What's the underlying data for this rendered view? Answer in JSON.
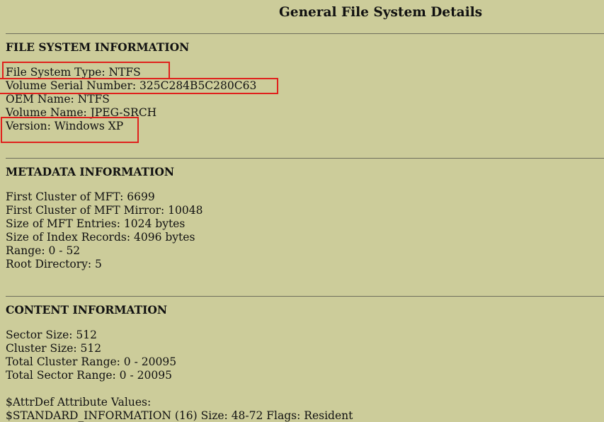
{
  "page": {
    "title": "General File System Details"
  },
  "file_system": {
    "heading": "FILE SYSTEM INFORMATION",
    "type": "File System Type: NTFS",
    "serial": "Volume Serial Number: 325C284B5C280C63",
    "oem": "OEM Name: NTFS",
    "volume_name": "Volume Name: JPEG-SRCH",
    "version": "Version: Windows XP"
  },
  "metadata": {
    "heading": "METADATA INFORMATION",
    "mft_first_cluster": "First Cluster of MFT: 6699",
    "mft_mirror_first_cluster": "First Cluster of MFT Mirror: 10048",
    "mft_entry_size": "Size of MFT Entries: 1024 bytes",
    "index_record_size": "Size of Index Records: 4096 bytes",
    "range": "Range: 0 - 52",
    "root_directory": "Root Directory: 5"
  },
  "content": {
    "heading": "CONTENT INFORMATION",
    "sector_size": "Sector Size: 512",
    "cluster_size": "Cluster Size: 512",
    "total_cluster_range": "Total Cluster Range: 0 - 20095",
    "total_sector_range": "Total Sector Range: 0 - 20095",
    "attrdef_title": "$AttrDef Attribute Values:",
    "attrdef_first": "$STANDARD_INFORMATION (16) Size: 48-72 Flags: Resident"
  },
  "colors": {
    "background": "#cccc9a",
    "highlight": "#e0201c"
  }
}
